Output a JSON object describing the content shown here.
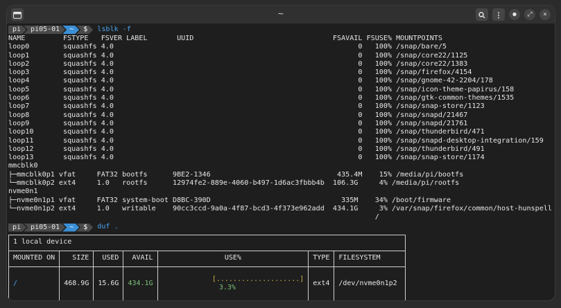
{
  "window": {
    "title": "~",
    "icons": {
      "left": "terminal-icon",
      "search": "search-icon",
      "menu": "kebab-menu-icon",
      "minimize": "minimize-icon",
      "maximize": "maximize-icon",
      "close": "close-icon"
    }
  },
  "prompt": {
    "user": "pi",
    "host": "pi05-01",
    "dir": "~",
    "symbol": "$"
  },
  "commands": [
    "lsblk -f",
    "duf ."
  ],
  "lsblk_header": "NAME         FSTYPE   FSVER LABEL       UUID                                 FSAVAIL FSUSE% MOUNTPOINTS",
  "lsblk_rows": [
    "loop0        squashfs 4.0                                                          0   100% /snap/bare/5",
    "loop1        squashfs 4.0                                                          0   100% /snap/core22/1125",
    "loop2        squashfs 4.0                                                          0   100% /snap/core22/1383",
    "loop3        squashfs 4.0                                                          0   100% /snap/firefox/4154",
    "loop4        squashfs 4.0                                                          0   100% /snap/gnome-42-2204/178",
    "loop5        squashfs 4.0                                                          0   100% /snap/icon-theme-papirus/158",
    "loop6        squashfs 4.0                                                          0   100% /snap/gtk-common-themes/1535",
    "loop7        squashfs 4.0                                                          0   100% /snap/snap-store/1123",
    "loop8        squashfs 4.0                                                          0   100% /snap/snapd/21467",
    "loop9        squashfs 4.0                                                          0   100% /snap/snapd/21761",
    "loop10       squashfs 4.0                                                          0   100% /snap/thunderbird/471",
    "loop11       squashfs 4.0                                                          0   100% /snap/snapd-desktop-integration/159",
    "loop12       squashfs 4.0                                                          0   100% /snap/thunderbird/491",
    "loop13       squashfs 4.0                                                          0   100% /snap/snap-store/1174",
    "mmcblk0",
    "├─mmcblk0p1 vfat     FAT32 bootfs      9BE2-1346                              435.4M    15% /media/pi/bootfs",
    "└─mmcblk0p2 ext4     1.0   rootfs      12974fe2-889e-4060-b497-1d6ac3fbbb4b  106.3G     4% /media/pi/rootfs",
    "nvme0n1",
    "├─nvme0n1p1 vfat     FAT32 system-boot D8BC-390D                               335M    34% /boot/firmware",
    "└─nvme0n1p2 ext4     1.0   writable    90cc3ccd-9a0a-4f87-bcd3-4f373e962add  434.1G     3% /var/snap/firefox/common/host-hunspell",
    "                                                                                       /"
  ],
  "duf": {
    "caption": "1 local device",
    "headers": [
      "MOUNTED ON",
      "SIZE",
      "USED",
      "AVAIL",
      "USE%",
      "TYPE",
      "FILESYSTEM"
    ],
    "row": {
      "mounted_on": "/",
      "size": "468.9G",
      "used": "15.6G",
      "avail": "434.1G",
      "bar": "[....................]",
      "use_pct": "3.3%",
      "type": "ext4",
      "filesystem": "/dev/nvme0n1p2"
    }
  },
  "colors": {
    "accent_blue": "#3b8fd6",
    "green": "#7ec27a",
    "yellow": "#c8b34a",
    "background": "#1e1e1e"
  }
}
